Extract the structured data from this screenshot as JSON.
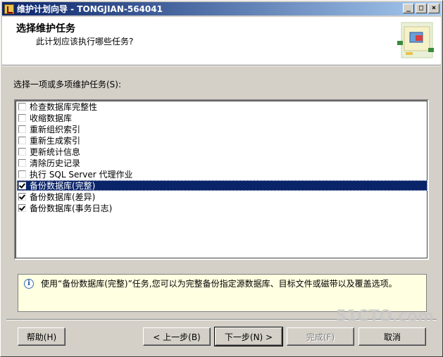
{
  "window": {
    "title": "维护计划向导 - TONGJIAN-564041",
    "minimize_glyph": "_",
    "maximize_glyph": "□",
    "close_glyph": "×"
  },
  "header": {
    "title": "选择维护任务",
    "subtitle": "此计划应该执行哪些任务?"
  },
  "task_list": {
    "label": "选择一项或多项维护任务(S):",
    "items": [
      {
        "label": "检查数据库完整性",
        "checked": false,
        "selected": false
      },
      {
        "label": "收缩数据库",
        "checked": false,
        "selected": false
      },
      {
        "label": "重新组织索引",
        "checked": false,
        "selected": false
      },
      {
        "label": "重新生成索引",
        "checked": false,
        "selected": false
      },
      {
        "label": "更新统计信息",
        "checked": false,
        "selected": false
      },
      {
        "label": "清除历史记录",
        "checked": false,
        "selected": false
      },
      {
        "label": "执行 SQL Server 代理作业",
        "checked": false,
        "selected": false
      },
      {
        "label": "备份数据库(完整)",
        "checked": true,
        "selected": true
      },
      {
        "label": "备份数据库(差异)",
        "checked": true,
        "selected": false
      },
      {
        "label": "备份数据库(事务日志)",
        "checked": true,
        "selected": false
      }
    ]
  },
  "description": {
    "icon": "info-icon",
    "text": "使用“备份数据库(完整)”任务,您可以为完整备份指定源数据库、目标文件或磁带以及覆盖选项。"
  },
  "buttons": {
    "help": "帮助(H)",
    "back": "< 上一步(B)",
    "next": "下一步(N) >",
    "finish": "完成(F)",
    "cancel": "取消"
  },
  "watermark": "51CTO.com",
  "colors": {
    "titlebar_start": "#0a246a",
    "titlebar_end": "#a6caf0",
    "selection": "#0a246a",
    "face": "#d4d0c8",
    "description_bg": "#ffffe1"
  }
}
